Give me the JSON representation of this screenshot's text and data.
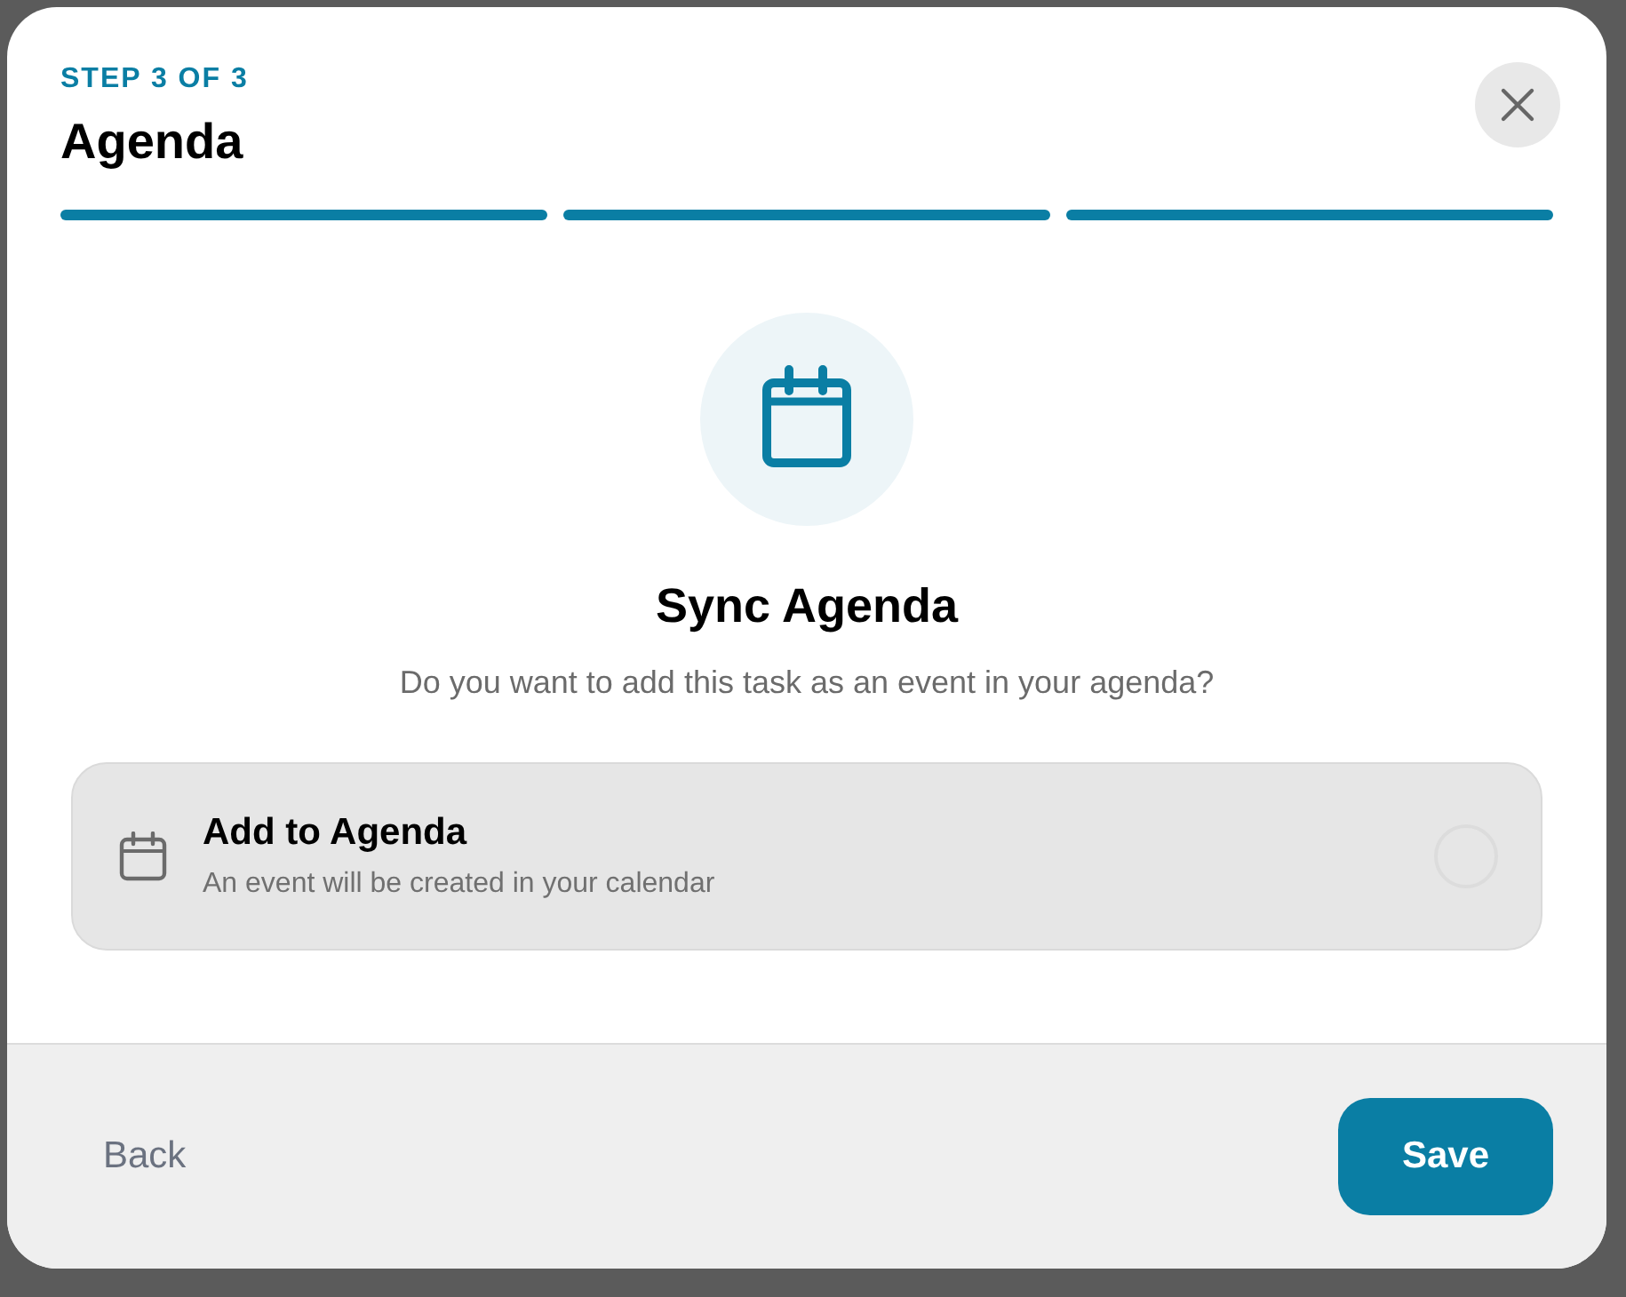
{
  "dialog": {
    "step_label": "STEP 3 OF 3",
    "title": "Agenda"
  },
  "progress": [
    {
      "complete": true
    },
    {
      "complete": true
    },
    {
      "complete": true
    }
  ],
  "hero": {
    "title": "Sync Agenda",
    "description": "Do you want to add this task as an event in your agenda?"
  },
  "options": [
    {
      "title": "Add to Agenda",
      "description": "An event will be created in your calendar",
      "selected": false
    }
  ],
  "footer": {
    "back": "Back",
    "save": "Save"
  }
}
